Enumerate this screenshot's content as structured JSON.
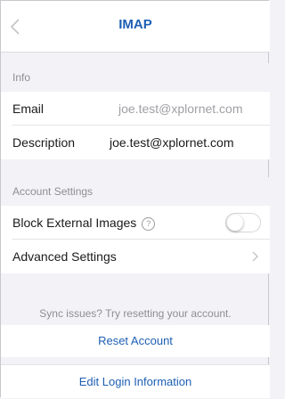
{
  "nav": {
    "title": "IMAP",
    "back_icon": "chevron-left-icon"
  },
  "sections": {
    "info": "Info",
    "account_settings": "Account Settings"
  },
  "info_rows": [
    {
      "label": "Email",
      "value": "joe.test@xplornet.com",
      "value_color": "#a0a0a5"
    },
    {
      "label": "Description",
      "value": "joe.test@xplornet.com",
      "value_color": "#1a1a1a"
    }
  ],
  "settings": {
    "block_external_images": {
      "label": "Block External Images",
      "help_glyph": "?",
      "enabled": false
    },
    "advanced": {
      "label": "Advanced Settings",
      "icon": "chevron-right-icon"
    }
  },
  "sync_hint": "Sync issues? Try resetting your account.",
  "actions": {
    "reset": "Reset Account",
    "edit_login": "Edit Login Information"
  },
  "colors": {
    "accent": "#1e5fb4",
    "background": "#f2f2f7",
    "muted": "#8e8e93"
  }
}
